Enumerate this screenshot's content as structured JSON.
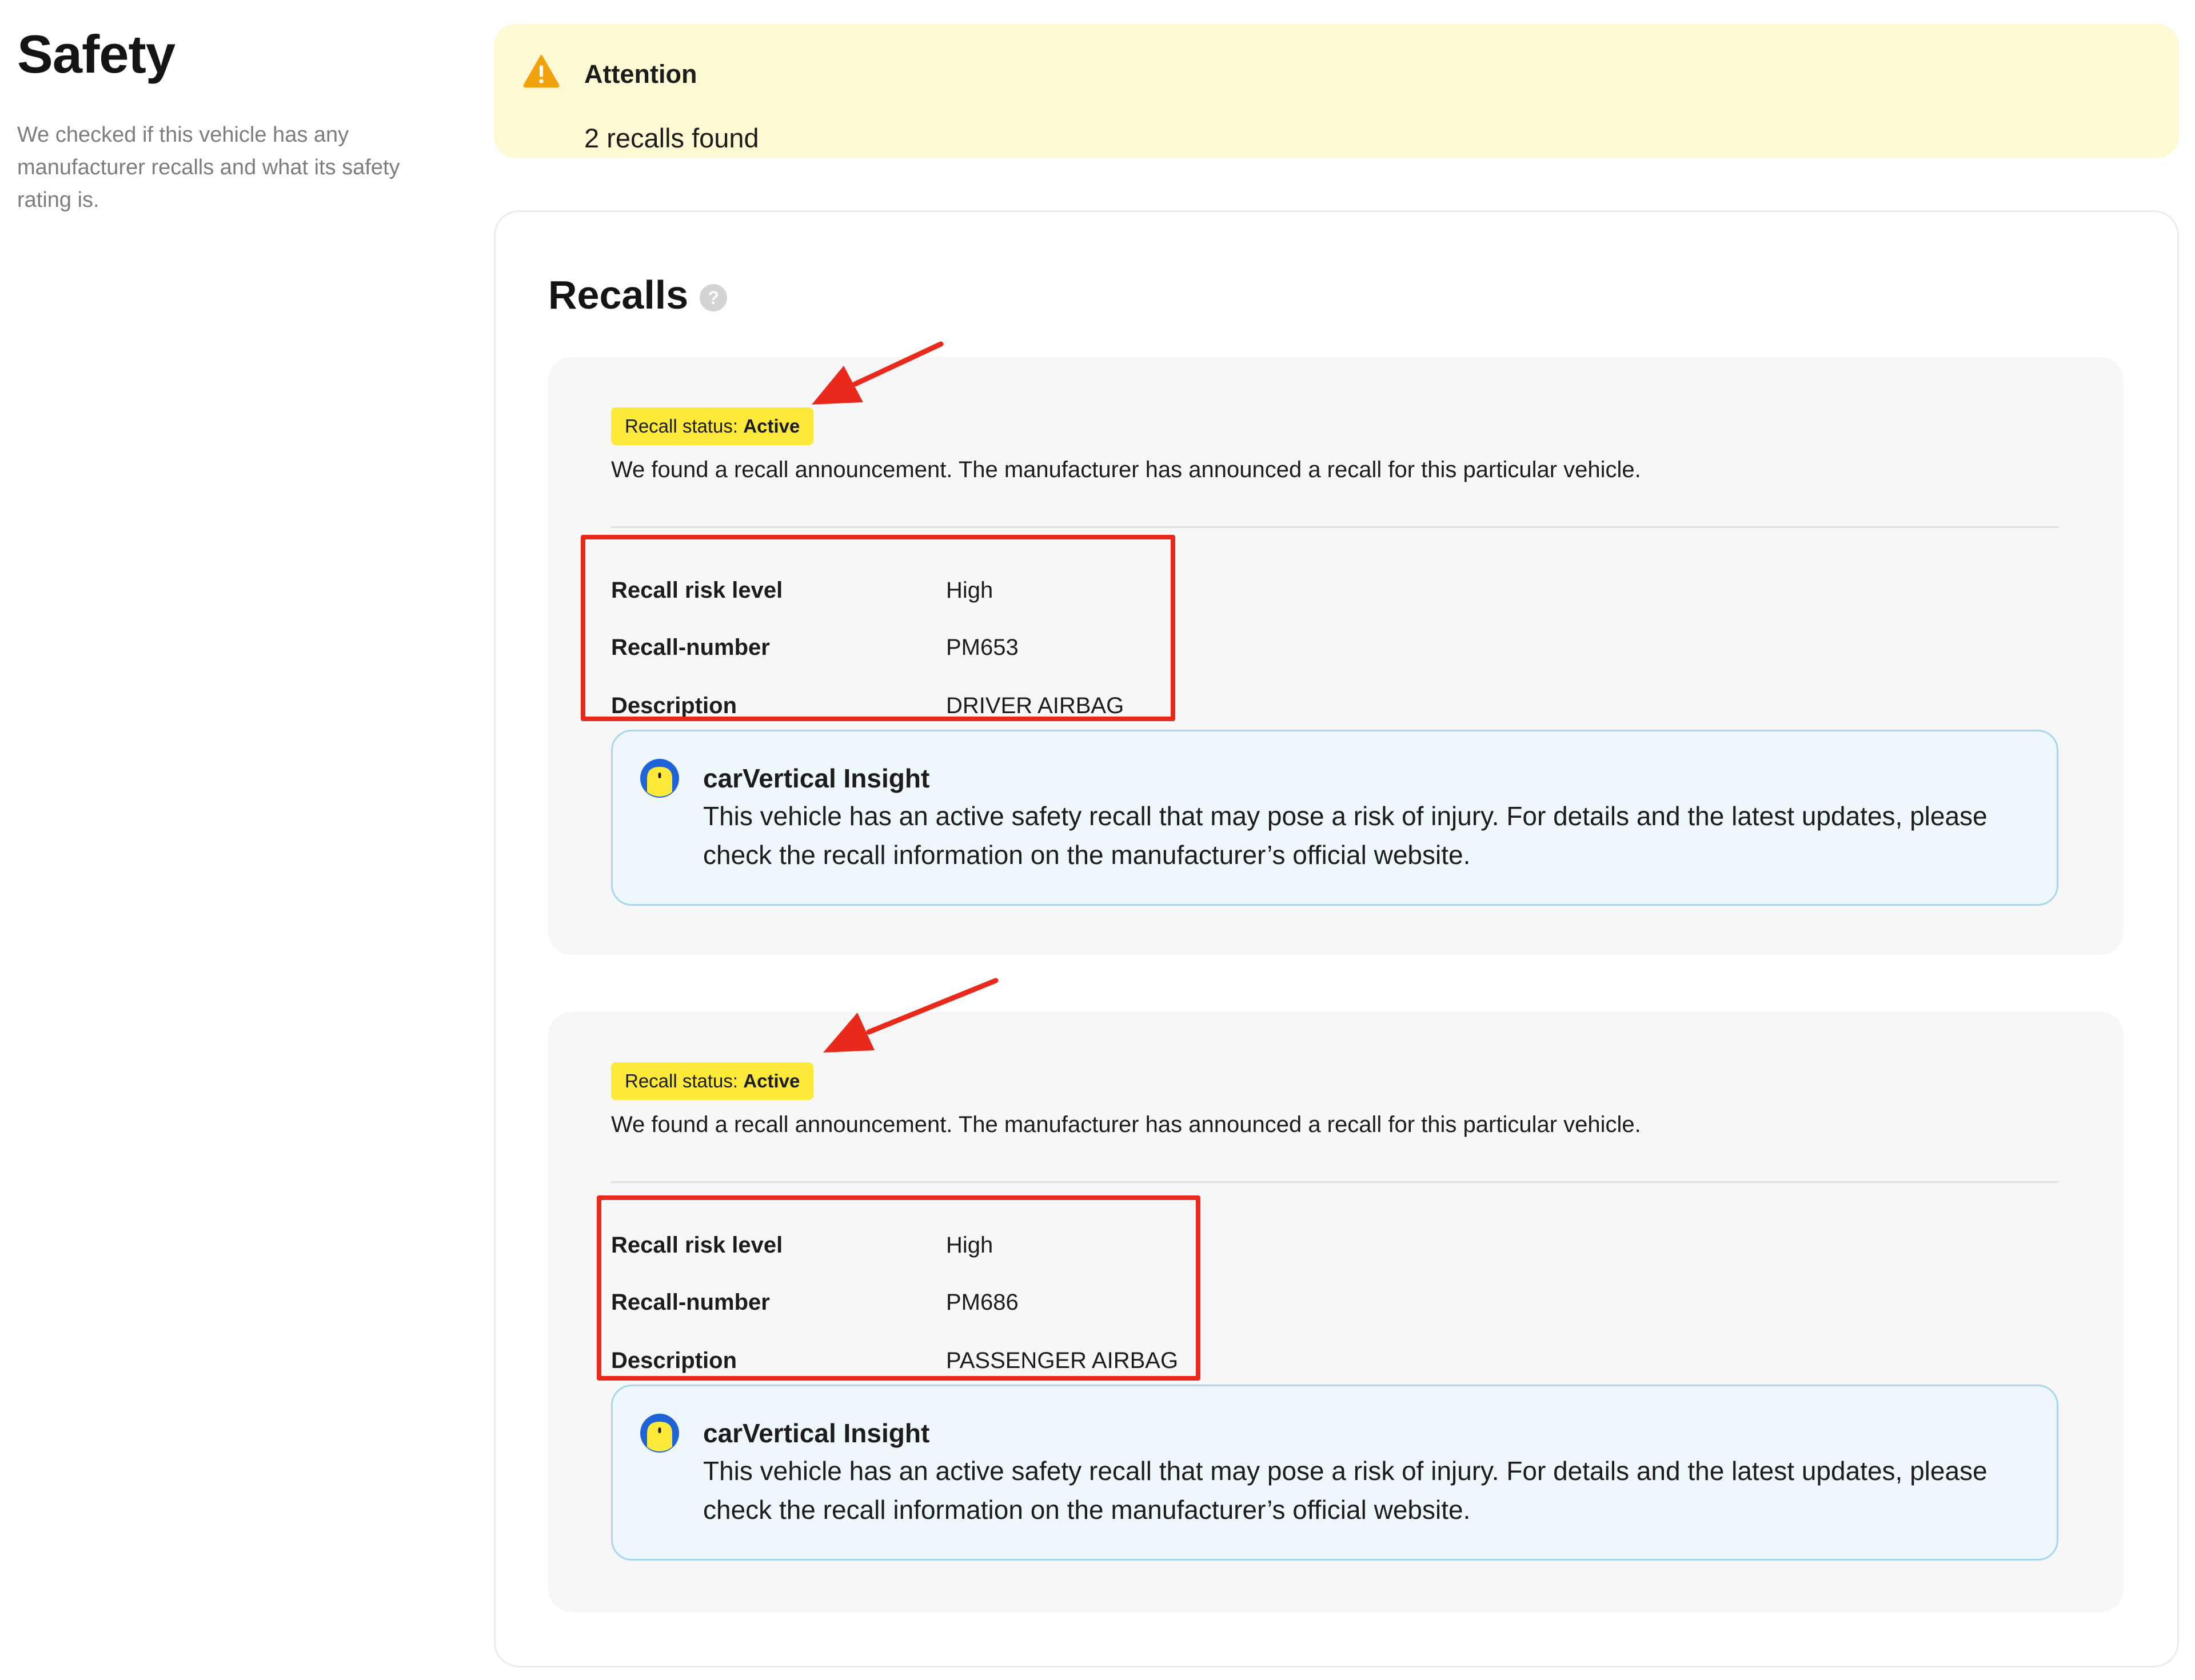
{
  "section": {
    "title": "Safety",
    "description": "We checked if this vehicle has any manufacturer recalls and what its safety rating is."
  },
  "attention": {
    "title": "Attention",
    "message": "2 recalls found",
    "icon": "warning-icon",
    "color": "#fdf9d2"
  },
  "recalls": {
    "heading": "Recalls",
    "help_icon": "question-icon",
    "help_glyph": "?",
    "items": [
      {
        "status_label": "Recall status:",
        "status_value": "Active",
        "description": "We found a recall announcement. The manufacturer has announced a recall for this particular vehicle.",
        "details": [
          {
            "label": "Recall risk level",
            "value": "High"
          },
          {
            "label": "Recall-number",
            "value": "PM653"
          },
          {
            "label": "Description",
            "value": "DRIVER AIRBAG"
          }
        ],
        "insight": {
          "title": "carVertical Insight",
          "text": "This vehicle has an active safety recall that may pose a risk of injury. For details and the latest updates, please check the recall information on the manufacturer’s official website."
        }
      },
      {
        "status_label": "Recall status:",
        "status_value": "Active",
        "description": "We found a recall announcement. The manufacturer has announced a recall for this particular vehicle.",
        "details": [
          {
            "label": "Recall risk level",
            "value": "High"
          },
          {
            "label": "Recall-number",
            "value": "PM686"
          },
          {
            "label": "Description",
            "value": "PASSENGER AIRBAG"
          }
        ],
        "insight": {
          "title": "carVertical Insight",
          "text": "This vehicle has an active safety recall that may pose a risk of injury. For details and the latest updates, please check the recall information on the manufacturer’s official website."
        }
      }
    ]
  },
  "colors": {
    "badge": "#fce93a",
    "annotation": "#e8291c",
    "insight_bg": "#edf7fc",
    "insight_border": "#a9d6ef"
  }
}
